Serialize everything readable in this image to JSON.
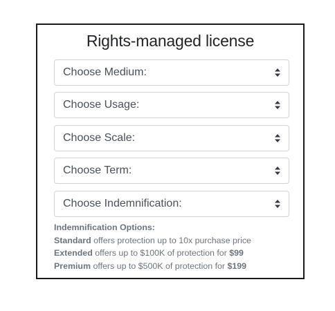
{
  "title": "Rights-managed license",
  "selects": [
    {
      "label": "Choose Medium:"
    },
    {
      "label": "Choose Usage:"
    },
    {
      "label": "Choose Scale:"
    },
    {
      "label": "Choose Term:"
    },
    {
      "label": "Choose Indemnification:"
    }
  ],
  "indemnification": {
    "heading": "Indemnification Options:",
    "standard": {
      "name": "Standard",
      "text": " offers protection up to 10x purchase price"
    },
    "extended": {
      "name": "Extended",
      "text": " offers up to $100K of protection for ",
      "price": "$99"
    },
    "premium": {
      "name": "Premium",
      "text": " offers up to $500K of protection for ",
      "price": "$199"
    }
  },
  "icons": {
    "select_caret": "sort-updown-icon"
  }
}
